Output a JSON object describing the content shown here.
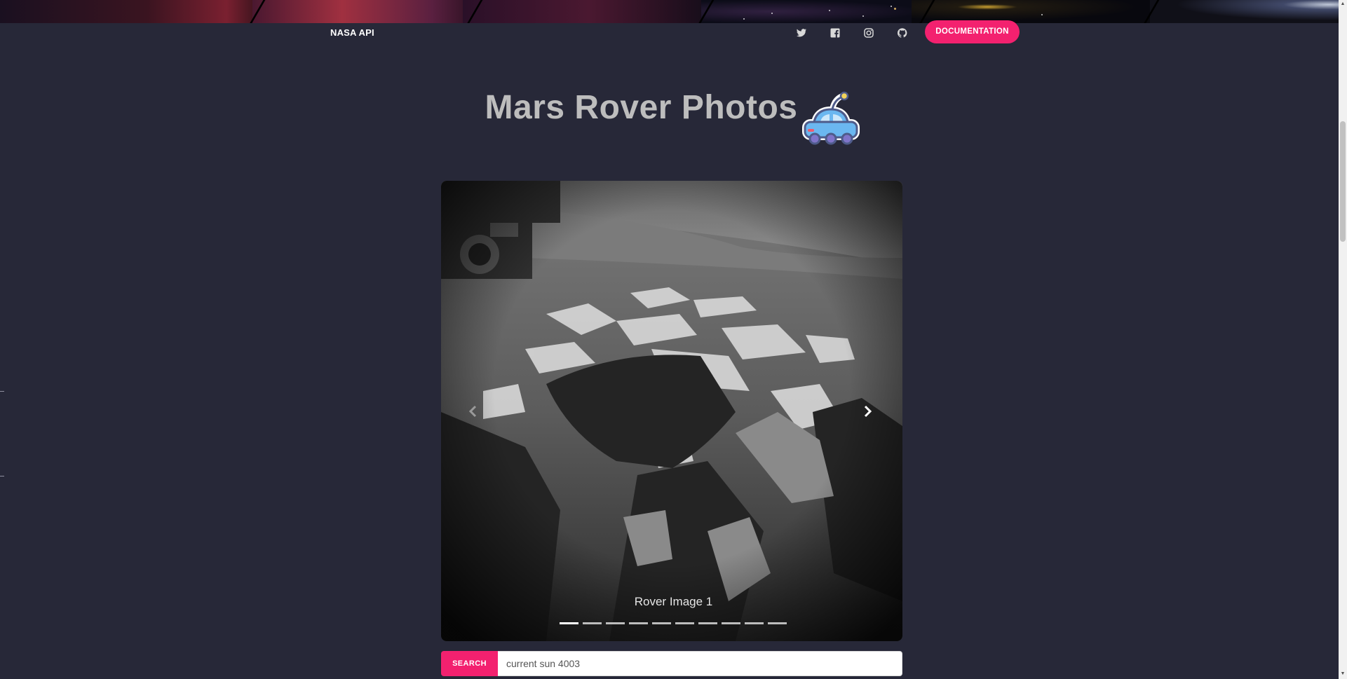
{
  "nav": {
    "brand": "NASA API",
    "documentation_label": "DOCUMENTATION",
    "social_icons": [
      "twitter-icon",
      "facebook-icon",
      "instagram-icon",
      "github-icon"
    ]
  },
  "hero": {
    "title": "Mars Rover Photos",
    "icon": "rover-icon"
  },
  "carousel": {
    "caption": "Rover Image 1",
    "slide_count": 10,
    "active_index": 0,
    "prev_icon": "chevron-left-icon",
    "next_icon": "chevron-right-icon"
  },
  "search": {
    "button_label": "SEARCH",
    "value": "current sun 4003"
  },
  "colors": {
    "background": "#272838",
    "accent": "#f3216f",
    "title": "#bdbdbd"
  }
}
